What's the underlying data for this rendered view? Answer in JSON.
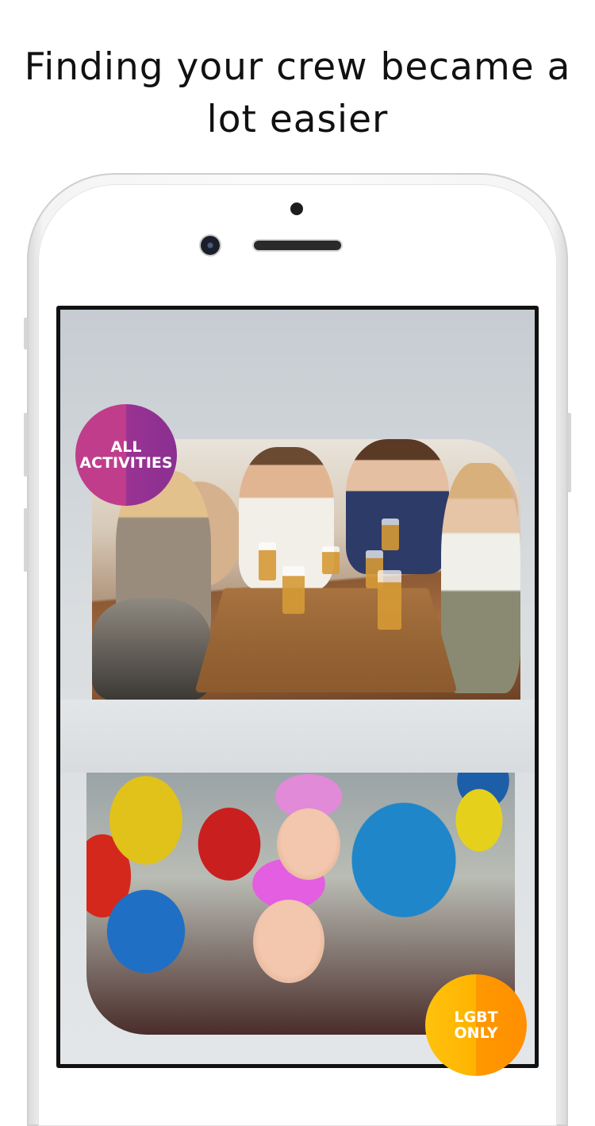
{
  "headline": {
    "line1": "Finding your crew became a",
    "line2": "lot easier"
  },
  "badges": {
    "activities": [
      "ALL",
      "ACTIVITIES"
    ],
    "lgbt": [
      "LGBT",
      "ONLY"
    ]
  },
  "colors": {
    "activities_badge": "#b23990",
    "lgbt_badge": "#ffa800",
    "screen_bg": "#dadee1"
  }
}
